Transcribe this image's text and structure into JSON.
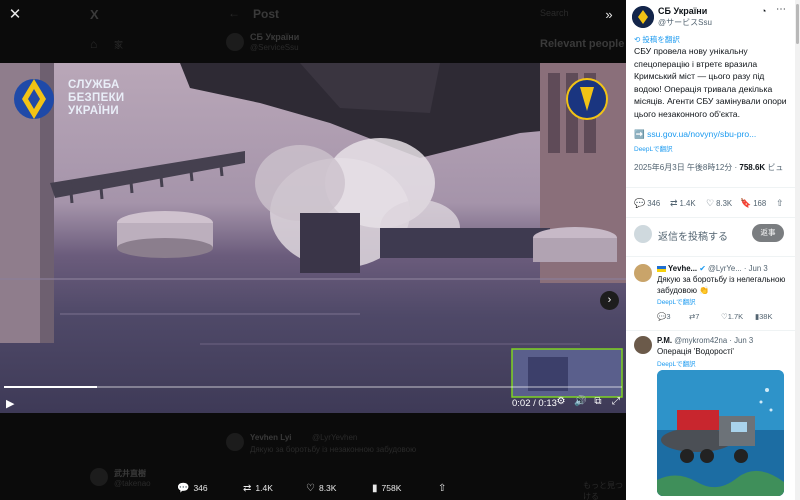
{
  "background": {
    "x_logo": "X",
    "header_title": "Post",
    "search_hint": "Search",
    "relevant_people": "Relevant people",
    "home_glyph": "家",
    "author_name": "СБ України",
    "author_handle": "@ServiceSsu",
    "reply_ghost_author": "Yevhen Lyi",
    "reply_ghost_handle": "@LyrYevhen",
    "reply_ghost_text": "Дякую за боротьбу із незаконною забудовою",
    "other_user_name": "武井直樹",
    "other_user_handle": "@takenao",
    "more_ghost": "もっと見つける"
  },
  "media": {
    "close_icon": "close-icon",
    "collapse_icon": "collapse-panel-icon",
    "watermark_text_lines": [
      "СЛУЖБА",
      "БЕЗПЕКИ",
      "УКРАЇНИ"
    ],
    "next_icon": "chevron-right-icon",
    "time_readout": "0:02 / 0:13",
    "progress_fraction": 0.15,
    "colors": {
      "accent": "#1d9bf0",
      "video_sky": "#b9a7b8",
      "video_water": "#4f4968"
    }
  },
  "bottom_actions": {
    "replies": "346",
    "reposts": "1.4K",
    "likes": "8.3K",
    "views": "758K"
  },
  "panel": {
    "author_name": "СБ України",
    "author_handle": "@サービスSsu",
    "translate_label": "投稿を翻訳",
    "post_text": "СБУ провела нову унікальну спецоперацію і втретє вразила Кримський міст — цього разу під водою! Операція тривала декілька місяців. Агенти СБУ замінували опори цього незаконного об'єкта.",
    "link_text": "➡️ ssu.gov.ua/novyny/sbu-pro...",
    "deepl_label": "DeepLで翻訳",
    "post_time": "2025年6月3日 午後8時12分 · ",
    "post_views": "758.6K",
    "post_views_suffix": " ビュ",
    "stats": {
      "replies": "346",
      "reposts": "1.4K",
      "likes": "8.3K",
      "bookmarks": "168"
    },
    "reply_placeholder": "返信を投稿する",
    "reply_button": "返事"
  },
  "replies": [
    {
      "author": "Yevhe...",
      "handle": "@LyrYe...",
      "date": "· Jun 3",
      "text": "Дякую за боротьбу із нелегальною забудовою 👏",
      "deepl": "DeepLで翻訳",
      "stats": {
        "replies": "3",
        "reposts": "7",
        "likes": "1.7K",
        "views": "38K"
      }
    },
    {
      "author": "P.M.",
      "handle": "@mykrom42na",
      "date": "· Jun 3",
      "text": "Операція 'Водорості'",
      "deepl": "DeepLで翻訳"
    }
  ]
}
